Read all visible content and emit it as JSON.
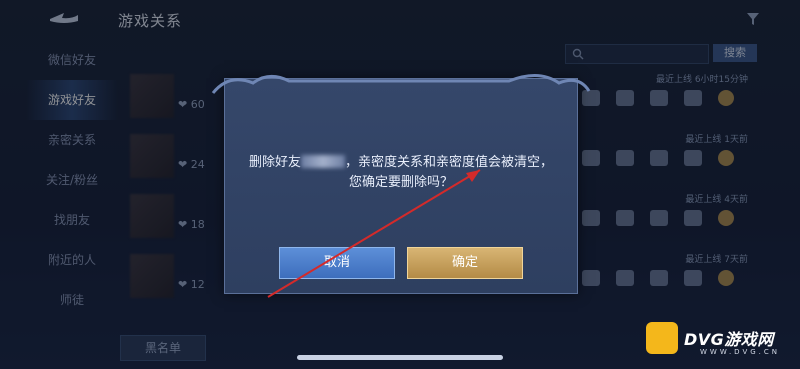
{
  "header": {
    "title": "游戏关系"
  },
  "sidebar": {
    "items": [
      {
        "label": "微信好友"
      },
      {
        "label": "游戏好友"
      },
      {
        "label": "亲密关系"
      },
      {
        "label": "关注/粉丝"
      },
      {
        "label": "找朋友"
      },
      {
        "label": "附近的人"
      },
      {
        "label": "师徒"
      }
    ],
    "blacklist_label": "黑名单"
  },
  "search": {
    "button_label": "搜索"
  },
  "rows": [
    {
      "heart": "60",
      "status": "最近上线 6小时15分钟"
    },
    {
      "heart": "24",
      "status": "最近上线 1天前"
    },
    {
      "heart": "18",
      "status": "最近上线 4天前"
    },
    {
      "heart": "12",
      "status": "最近上线 7天前"
    }
  ],
  "dialog": {
    "line1_prefix": "删除好友",
    "line1_suffix": "，亲密度关系和亲密度值会被清空，",
    "line2": "您确定要删除吗？",
    "cancel_label": "取消",
    "confirm_label": "确定"
  },
  "watermark": {
    "name": "DVG游戏网",
    "sub": "WWW.DVG.CN"
  },
  "colors": {
    "accent_blue": "#3d6ebd",
    "accent_gold": "#c9a155",
    "arrow_red": "#d42a2a"
  }
}
